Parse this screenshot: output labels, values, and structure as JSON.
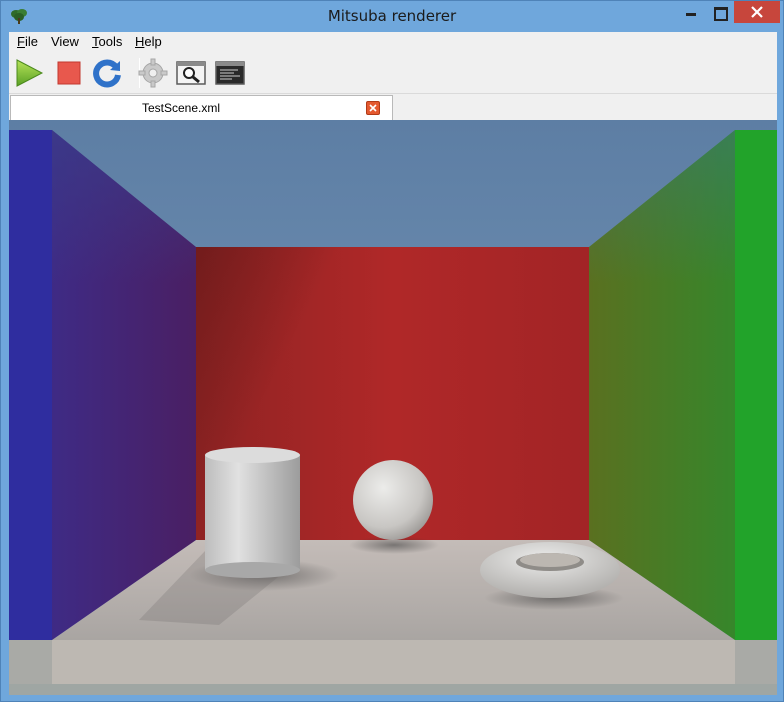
{
  "window": {
    "title": "Mitsuba renderer",
    "controls": [
      "minimize",
      "maximize",
      "close"
    ]
  },
  "menu": {
    "file": {
      "accel": "F",
      "rest": "ile"
    },
    "view": {
      "label": "View"
    },
    "tools": {
      "accel": "T",
      "rest": "ools"
    },
    "help": {
      "accel": "H",
      "rest": "elp"
    }
  },
  "toolbar": {
    "buttons": [
      {
        "icon": "play-icon",
        "action": "start-render"
      },
      {
        "icon": "stop-icon",
        "action": "stop-render"
      },
      {
        "icon": "refresh-icon",
        "action": "refresh"
      },
      {
        "icon": "gear-icon",
        "action": "settings",
        "enabled": false
      },
      {
        "icon": "magnifier-icon",
        "action": "inspect"
      },
      {
        "icon": "console-icon",
        "action": "log"
      }
    ]
  },
  "tabs": [
    {
      "label": "TestScene.xml",
      "active": true
    }
  ],
  "colors": {
    "titlebar": "#6fa7dc",
    "close_button": "#c7463c",
    "back_wall": "#b02828",
    "left_wall": "#2d2c9a",
    "right_wall": "#259a2c",
    "floor": "#b4b0ab",
    "sky": "#6b8cb0"
  }
}
